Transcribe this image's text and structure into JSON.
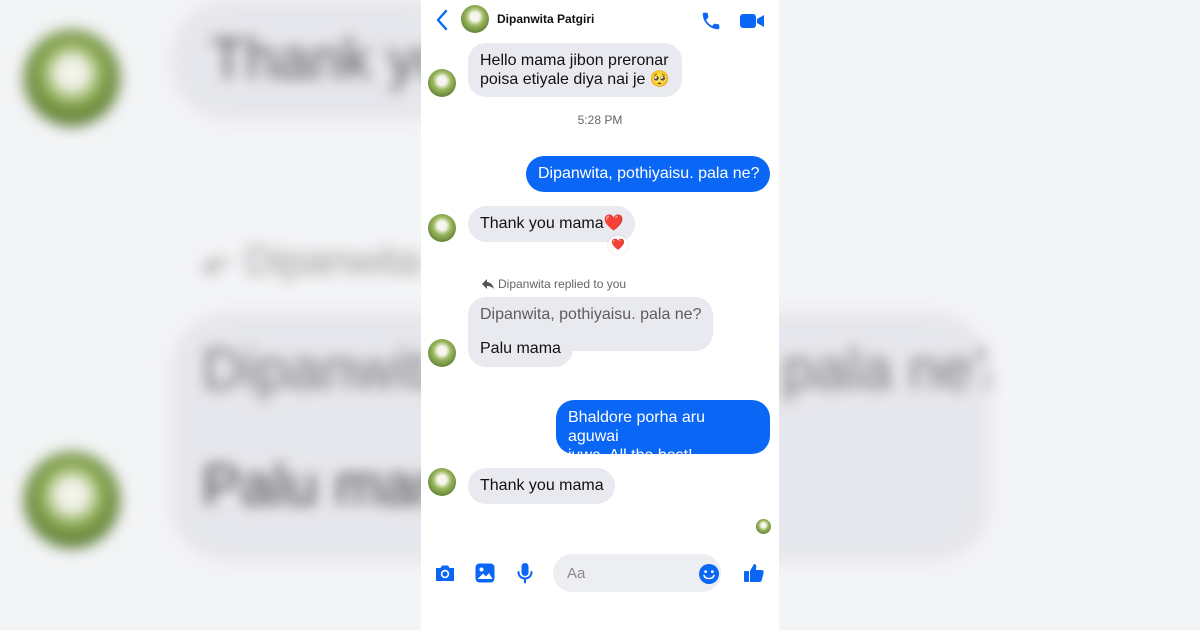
{
  "header": {
    "contact_name": "Dipanwita Patgiri",
    "back_icon": "chevron-left-icon",
    "call_icon": "phone-icon",
    "video_icon": "video-camera-icon"
  },
  "messages": {
    "m1": {
      "line1": "Hello mama jibon preronar",
      "line2": "poisa etiyale diya nai je 🥺"
    },
    "timestamp": "5:28 PM",
    "m2": "Dipanwita, pothiyaisu. pala ne?",
    "m3": "Thank you mama❤️",
    "m3_reaction": "❤️",
    "replied_label": "Dipanwita replied to you",
    "m4_quote": "Dipanwita, pothiyaisu. pala ne?",
    "m4": "Palu mama",
    "m5": {
      "line1": "Bhaldore porha aru aguwai",
      "line2": "juwa. All the best!"
    },
    "m6": "Thank you mama"
  },
  "composer": {
    "placeholder": "Aa",
    "icons": [
      "camera-icon",
      "image-icon",
      "microphone-icon",
      "emoji-icon",
      "thumbs-up-icon"
    ]
  },
  "background": {
    "text_thank": "Thank you mama",
    "text_replied": "Dipanwita replied to you",
    "text_quote": "Dipanwita, pothiyaisu. pala ne?",
    "text_palu": "Palu mama"
  },
  "colors": {
    "accent": "#0a66f5",
    "incoming_bubble": "#e9eaef",
    "outgoing_bubble": "#0a66f5"
  }
}
